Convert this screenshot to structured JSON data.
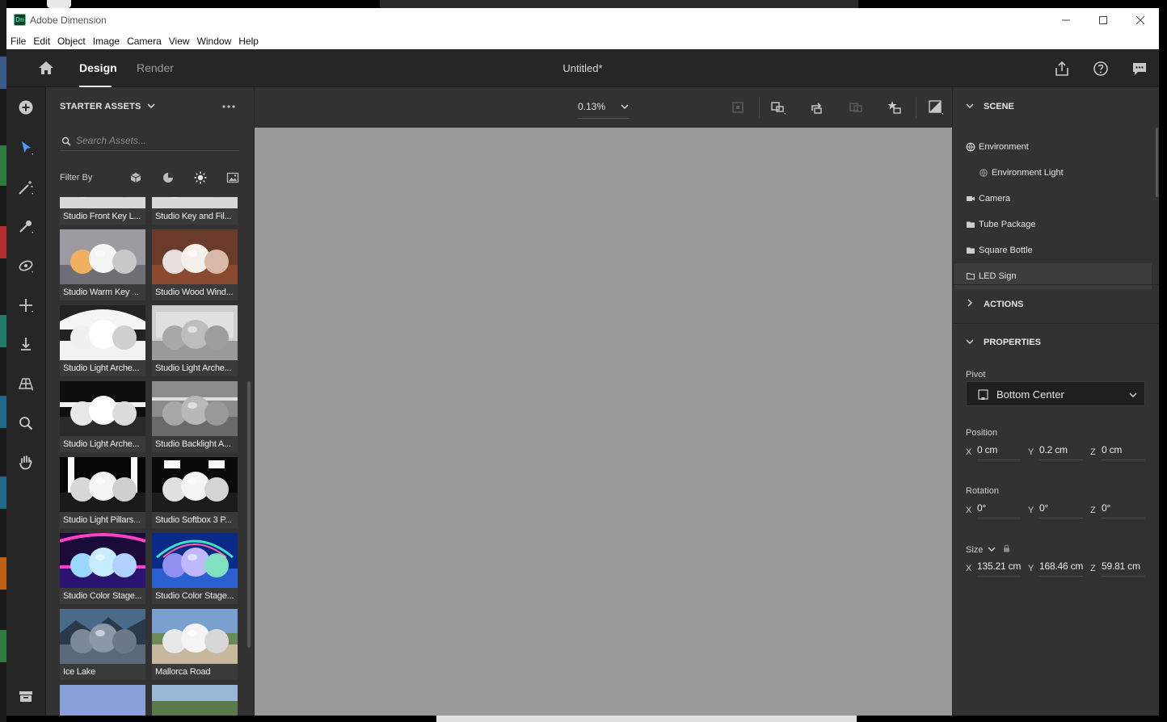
{
  "window": {
    "title": "Adobe Dimension",
    "logo_text": "Dn"
  },
  "menu": [
    "File",
    "Edit",
    "Object",
    "Image",
    "Camera",
    "View",
    "Window",
    "Help"
  ],
  "header": {
    "tabs": [
      "Design",
      "Render"
    ],
    "active_tab": "Design",
    "doc_title": "Untitled*"
  },
  "assets": {
    "title": "STARTER ASSETS",
    "search_placeholder": "Search Assets...",
    "filter_label": "Filter By",
    "items": [
      {
        "label": "Studio Front Key L...",
        "style": "studio-white"
      },
      {
        "label": "Studio Key and Fil...",
        "style": "studio-white"
      },
      {
        "label": "Studio Warm Key ...",
        "style": "studio-warm"
      },
      {
        "label": "Studio Wood Wind...",
        "style": "studio-wood"
      },
      {
        "label": "Studio Light Arche...",
        "style": "studio-arch-white"
      },
      {
        "label": "Studio Light Arche...",
        "style": "studio-arch-grey"
      },
      {
        "label": "Studio Light Arche...",
        "style": "studio-dark-bands"
      },
      {
        "label": "Studio Backlight A...",
        "style": "studio-backlight"
      },
      {
        "label": "Studio Light Pillars...",
        "style": "studio-pillars"
      },
      {
        "label": "Studio Softbox 3 P...",
        "style": "studio-softbox"
      },
      {
        "label": "Studio Color Stage...",
        "style": "color-stage-magenta"
      },
      {
        "label": "Studio Color Stage...",
        "style": "color-stage-blue"
      },
      {
        "label": "Ice Lake",
        "style": "ice-lake"
      },
      {
        "label": "Mallorca Road",
        "style": "mallorca-road"
      },
      {
        "label": "",
        "style": "sky"
      },
      {
        "label": "",
        "style": "landscape"
      }
    ]
  },
  "viewport": {
    "zoom": "0.13%"
  },
  "scene": {
    "title": "SCENE",
    "items": [
      {
        "label": "Environment",
        "icon": "globe-icon",
        "indent": 0,
        "selected": false
      },
      {
        "label": "Environment Light",
        "icon": "globe-small-icon",
        "indent": 1,
        "selected": false
      },
      {
        "label": "Camera",
        "icon": "camera-icon",
        "indent": 0,
        "selected": false
      },
      {
        "label": "Tube Package",
        "icon": "folder-icon",
        "indent": 0,
        "selected": false
      },
      {
        "label": "Square Bottle",
        "icon": "folder-icon",
        "indent": 0,
        "selected": false
      },
      {
        "label": "LED Sign",
        "icon": "folder-outline-icon",
        "indent": 0,
        "selected": true
      }
    ]
  },
  "actions": {
    "title": "ACTIONS"
  },
  "properties": {
    "title": "PROPERTIES",
    "pivot_label": "Pivot",
    "pivot_value": "Bottom Center",
    "position_label": "Position",
    "position": {
      "x": "0 cm",
      "y": "0.2 cm",
      "z": "0 cm"
    },
    "rotation_label": "Rotation",
    "rotation": {
      "x": "0°",
      "y": "0°",
      "z": "0°"
    },
    "size_label": "Size",
    "size": {
      "x": "135.21 cm",
      "y": "168.46 cm",
      "z": "59.81 cm"
    },
    "axis_labels": {
      "x": "X",
      "y": "Y",
      "z": "Z"
    }
  },
  "colors": {
    "accent": "#4b9cff",
    "panel": "#323232",
    "header": "#262626",
    "canvas": "#9a9a9a"
  }
}
